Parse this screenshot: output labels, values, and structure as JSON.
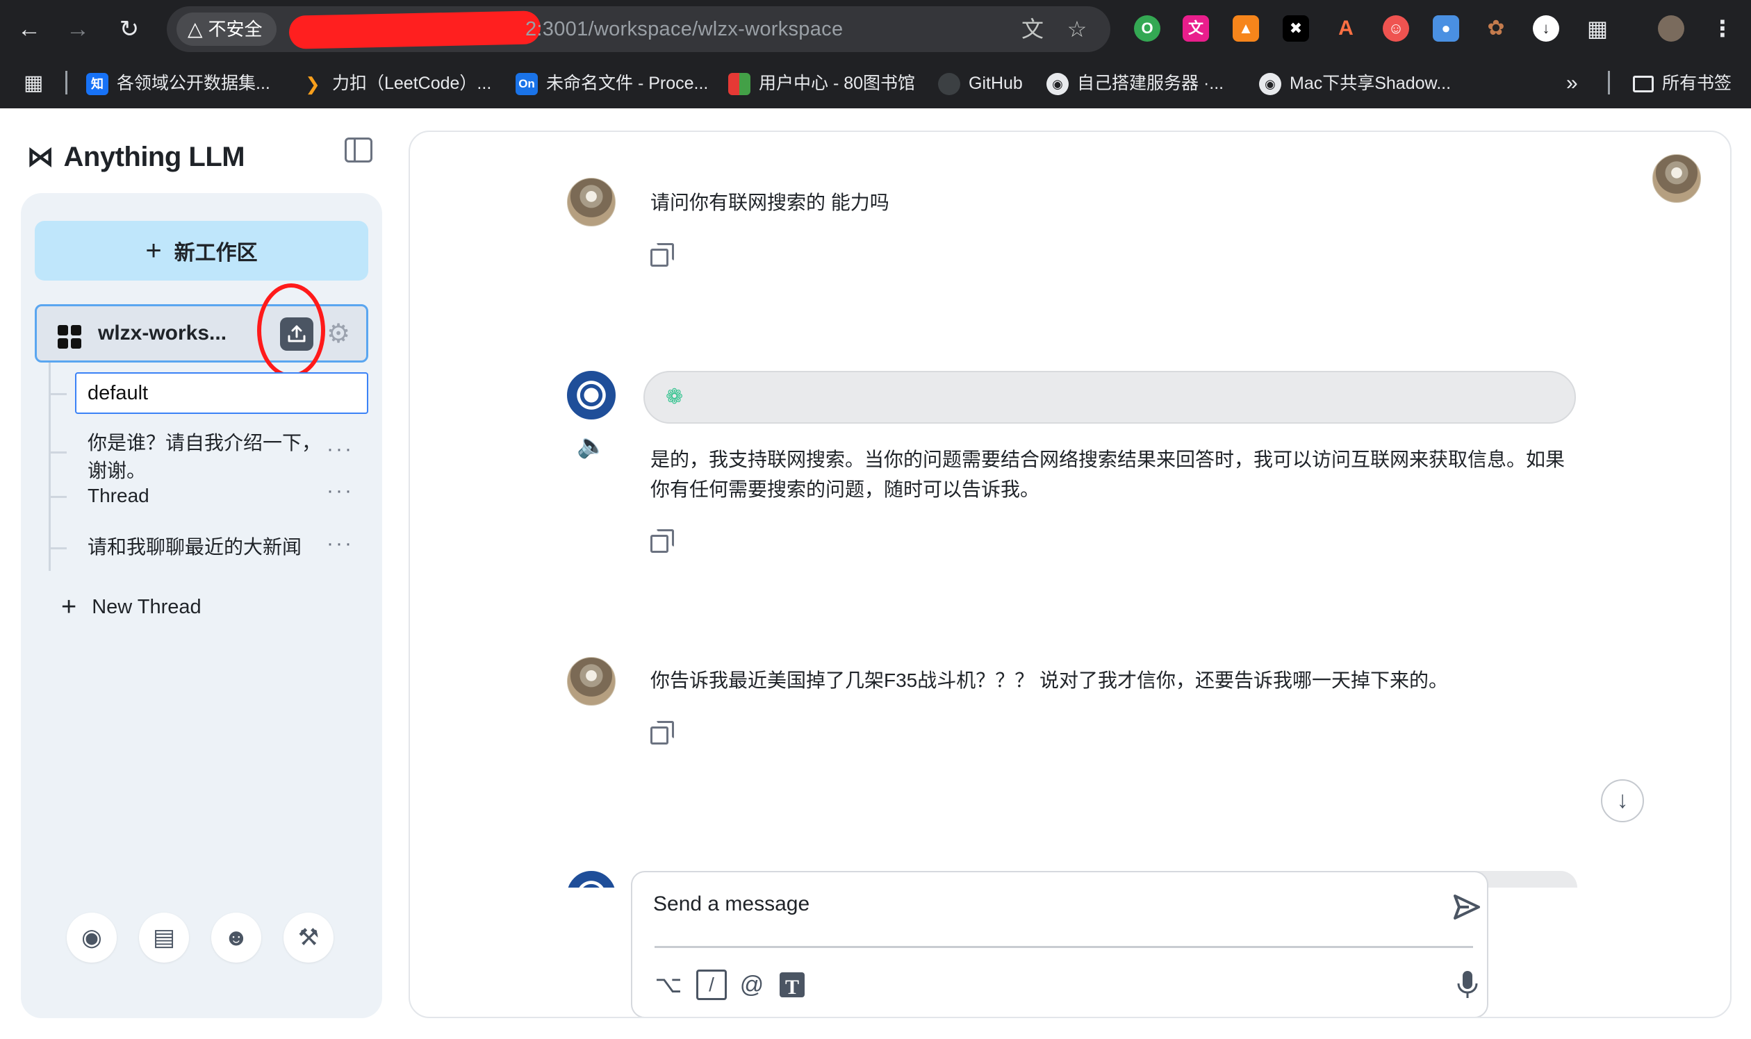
{
  "browser": {
    "security_label": "不安全",
    "url": "2:3001/workspace/wlzx-workspace",
    "bookmarks": [
      {
        "label": "各领域公开数据集...",
        "icon": "zhihu-icon",
        "color": "#1772f6",
        "glyph": "知"
      },
      {
        "label": "力扣（LeetCode）...",
        "icon": "leetcode-icon",
        "color": "#f89f1b",
        "glyph": ""
      },
      {
        "label": "未命名文件 - Proce...",
        "icon": "processon-icon",
        "color": "#1a73e8",
        "glyph": "On"
      },
      {
        "label": "用户中心 - 80图书馆",
        "icon": "library-icon",
        "color": "#e53935",
        "glyph": ""
      },
      {
        "label": "GitHub",
        "icon": "github-icon",
        "color": "#24292f",
        "glyph": ""
      },
      {
        "label": "自己搭建服务器 ·...",
        "icon": "globe-icon",
        "color": "#5f6368",
        "glyph": ""
      },
      {
        "label": "Mac下共享Shadow...",
        "icon": "globe-icon",
        "color": "#5f6368",
        "glyph": ""
      }
    ],
    "all_bookmarks": "所有书签"
  },
  "app": {
    "logo_text": "Anything LLM",
    "new_workspace": "新工作区",
    "workspace_name": "wlzx-works...",
    "threads": {
      "default": "default",
      "t1_line1": "你是谁？请自我介绍一下，",
      "t1_line2": "谢谢。",
      "t2": "Thread",
      "t3": "请和我聊聊最近的大新闻"
    },
    "new_thread": "New Thread",
    "more_glyph": "···"
  },
  "chat": {
    "m1": "请问你有联网搜索的 能力吗",
    "m2_line1": "是的，我支持联网搜索。当你的问题需要结合网络搜索结果来回答时，我可以访问互联网来获取信息。如果",
    "m2_line2": "你有任何需要搜索的问题，随时可以告诉我。",
    "m3": "你告诉我最近美国掉了几架F35战斗机？？？ 说对了我才信你，还要告诉我哪一天掉下来的。"
  },
  "composer": {
    "placeholder": "Send a message"
  },
  "colors": {
    "accent_blue": "#5aa6f0",
    "new_ws_bg": "#bfe6fb",
    "annotation_red": "#ff1a1a"
  }
}
